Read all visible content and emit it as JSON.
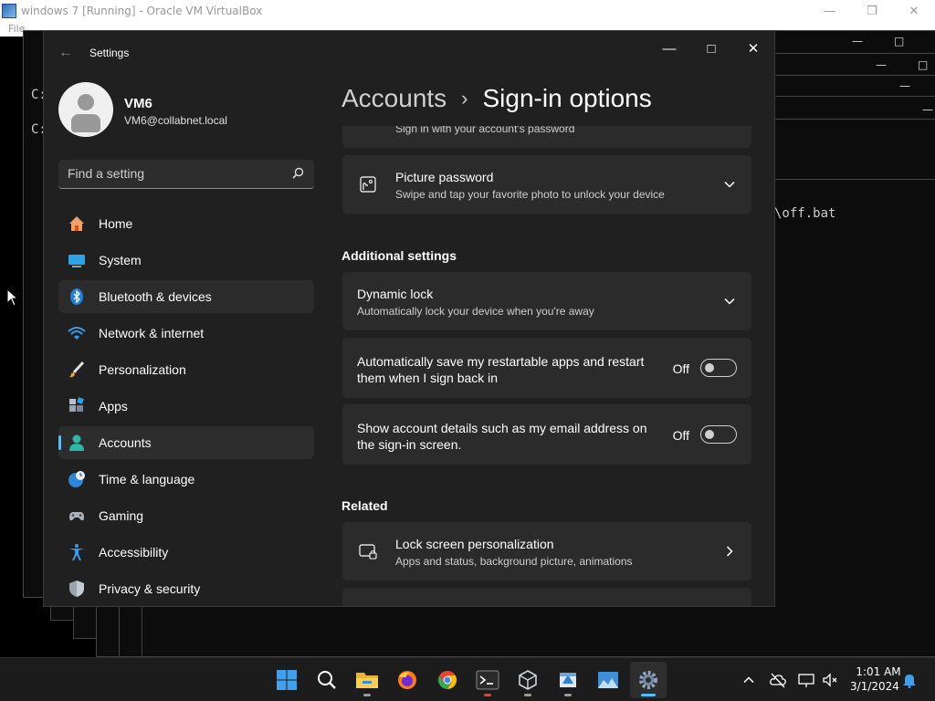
{
  "host": {
    "title": "windows 7 [Running] - Oracle VM VirtualBox",
    "menu_first": "File"
  },
  "console": {
    "prompt_1": "C:",
    "prompt_2": "C:",
    "text_fragment": "\\off.bat"
  },
  "settings": {
    "app_title": "Settings",
    "profile": {
      "name": "VM6",
      "email": "VM6@collabnet.local"
    },
    "search": {
      "placeholder": "Find a setting"
    },
    "nav": [
      {
        "label": "Home",
        "icon": "home-icon"
      },
      {
        "label": "System",
        "icon": "system-icon"
      },
      {
        "label": "Bluetooth & devices",
        "icon": "bluetooth-icon"
      },
      {
        "label": "Network & internet",
        "icon": "wifi-icon"
      },
      {
        "label": "Personalization",
        "icon": "brush-icon"
      },
      {
        "label": "Apps",
        "icon": "apps-icon"
      },
      {
        "label": "Accounts",
        "icon": "accounts-icon"
      },
      {
        "label": "Time & language",
        "icon": "globe-clock-icon"
      },
      {
        "label": "Gaming",
        "icon": "gamepad-icon"
      },
      {
        "label": "Accessibility",
        "icon": "accessibility-icon"
      },
      {
        "label": "Privacy & security",
        "icon": "shield-icon"
      }
    ],
    "breadcrumb": {
      "parent": "Accounts",
      "separator": "›",
      "current": "Sign-in options"
    },
    "password_card": {
      "subtitle": "Sign in with your account's password"
    },
    "picture_password": {
      "title": "Picture password",
      "subtitle": "Swipe and tap your favorite photo to unlock your device"
    },
    "additional_settings": {
      "title": "Additional settings"
    },
    "dynamic_lock": {
      "title": "Dynamic lock",
      "subtitle": "Automatically lock your device when you're away"
    },
    "restart_apps": {
      "line1": "Automatically save my restartable apps and restart",
      "line2": "them when I sign back in",
      "state": "Off"
    },
    "account_details": {
      "line1": "Show account details such as my email address on",
      "line2": "the sign-in screen.",
      "state": "Off"
    },
    "related": {
      "title": "Related"
    },
    "lock_screen": {
      "title": "Lock screen personalization",
      "subtitle": "Apps and status, background picture, animations"
    }
  },
  "taskbar": {
    "time": "1:01 AM",
    "date": "3/1/2024"
  },
  "colors": {
    "accent": "#4cc2ff",
    "window_bg": "#202020",
    "card_bg": "#2b2b2b"
  }
}
